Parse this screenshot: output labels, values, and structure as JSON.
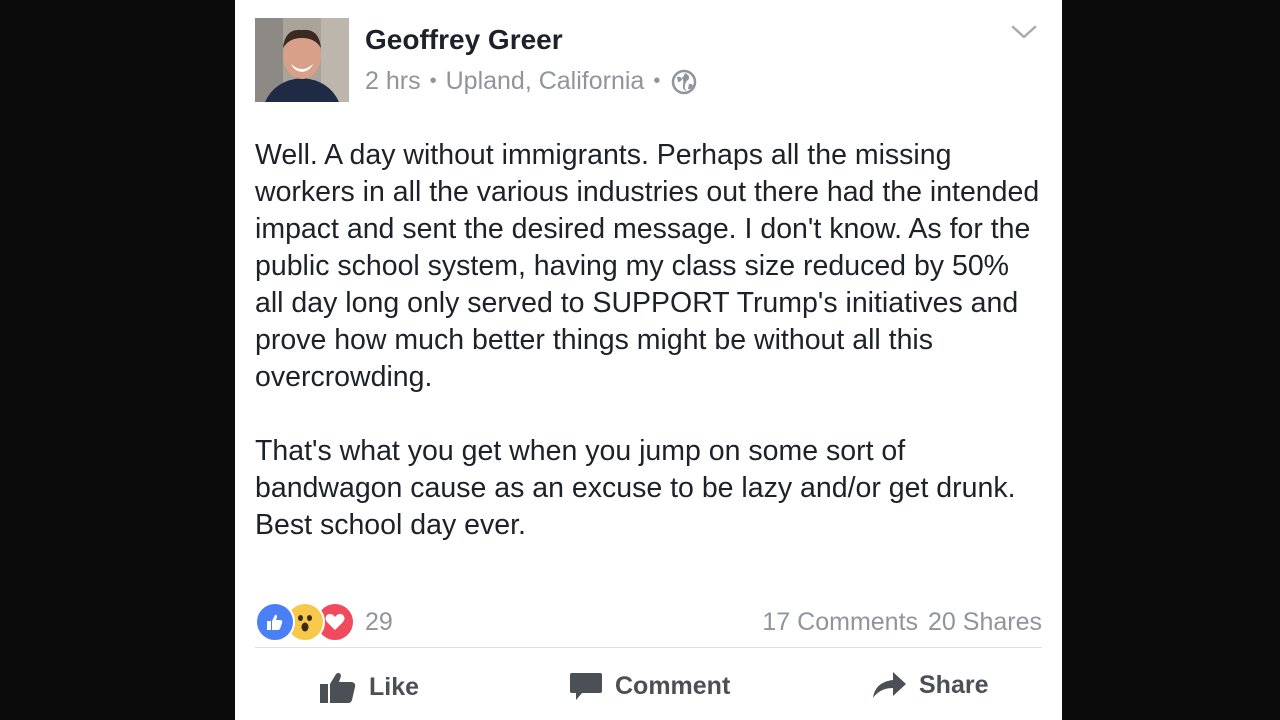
{
  "post": {
    "author": "Geoffrey Greer",
    "time": "2 hrs",
    "location": "Upland, California",
    "privacy_icon": "globe-icon",
    "menu_icon": "chevron-down-icon",
    "paragraphs": [
      "Well. A day without immigrants. Perhaps all the missing workers in all the various industries out there had the intended impact and sent the desired message. I don't know. As for the public school system, having my class size reduced by 50% all day long only served to SUPPORT Trump's initiatives and prove how much better things might be without all this overcrowding.",
      "That's what you get when you jump on some sort of bandwagon cause as an excuse to be lazy and/or get drunk. Best school day ever."
    ]
  },
  "engagement": {
    "reaction_icons": [
      "like-icon",
      "wow-icon",
      "love-icon"
    ],
    "reaction_count": "29",
    "comments": "17 Comments",
    "shares": "20 Shares"
  },
  "actions": {
    "like": "Like",
    "comment": "Comment",
    "share": "Share"
  },
  "colors": {
    "like_blue": "#4a7ff5",
    "wow_yellow": "#f7c84b",
    "love_red": "#ef4b5c",
    "meta_gray": "#90949c"
  }
}
